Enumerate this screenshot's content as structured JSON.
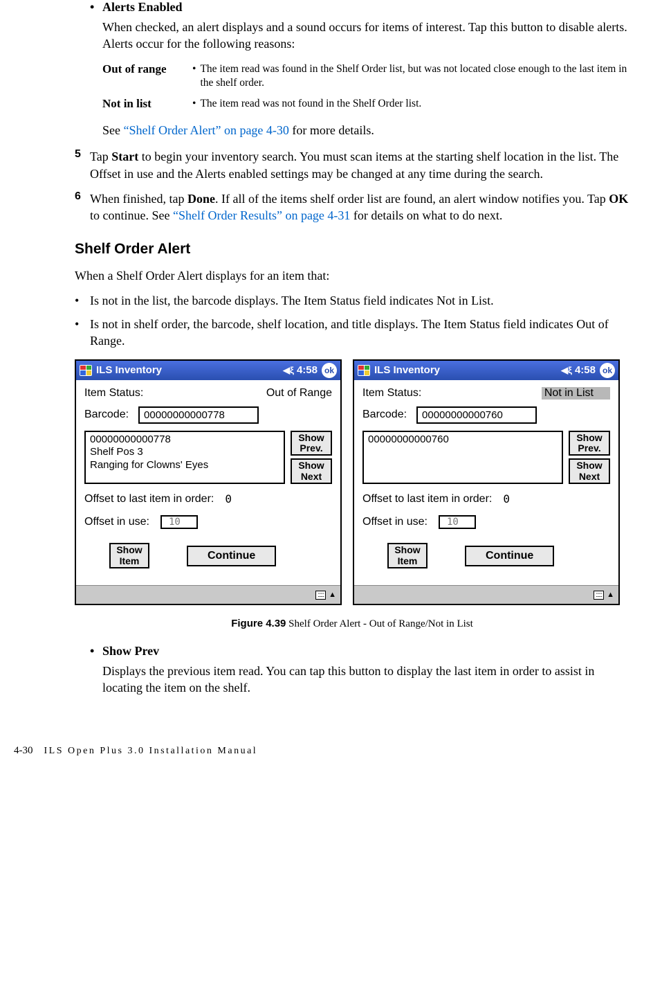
{
  "bullet_alerts_heading": "Alerts Enabled",
  "alerts_para": "When checked, an alert displays and a sound occurs for items of interest. Tap this button to disable alerts. Alerts occur for the following reasons:",
  "alert_table": {
    "out_of_range_term": "Out of range",
    "out_of_range_desc": "The item read was found in the Shelf Order list, but was not located close enough to the last item in the shelf order.",
    "not_in_list_term": "Not in list",
    "not_in_list_desc": "The item read was not found in the Shelf Order list."
  },
  "see_prefix": "See ",
  "see_link": "“Shelf Order Alert” on page 4-30",
  "see_suffix": " for more details.",
  "step5_num": "5",
  "step5_a": "Tap ",
  "step5_b": "Start",
  "step5_c": " to begin your inventory search. You must scan items at the starting shelf location in the list. The Offset in use and the Alerts enabled settings may be changed at any time during the search.",
  "step6_num": "6",
  "step6_a": "When finished, tap ",
  "step6_b": "Done",
  "step6_c": ". If all of the items shelf order list are found, an alert window notifies you. Tap ",
  "step6_d": "OK",
  "step6_e": " to continue. See ",
  "step6_link": "“Shelf Order Results” on page 4-31",
  "step6_f": " for details on what to do next.",
  "section_heading": "Shelf Order Alert",
  "section_intro": "When a Shelf Order Alert displays for an item that:",
  "list1": "Is not in the list, the barcode displays. The Item Status field indicates Not in List.",
  "list2": "Is not in shelf order, the barcode, shelf location, and title displays. The Item Status field indicates Out of Range.",
  "screens": {
    "app_title": "ILS Inventory",
    "time": "4:58",
    "ok": "ok",
    "item_status_label": "Item Status:",
    "barcode_label": "Barcode:",
    "show_prev": "Show\nPrev.",
    "show_next": "Show\nNext",
    "offset_last_label": "Offset to last item in order:",
    "offset_last_val": "0",
    "offset_inuse_label": "Offset in use:",
    "offset_inuse_val": "10",
    "show_item": "Show\nItem",
    "continue": "Continue",
    "left": {
      "status": "Out of Range",
      "barcode": "00000000000778",
      "line1": "00000000000778",
      "line2": "Shelf Pos 3",
      "line3": "Ranging for Clowns' Eyes"
    },
    "right": {
      "status": "Not in List",
      "barcode": "00000000000760",
      "line1": "00000000000760",
      "line2": "",
      "line3": ""
    }
  },
  "figure_label": "Figure 4.39",
  "figure_caption": " Shelf Order Alert - Out of Range/Not in List",
  "show_prev_heading": "Show Prev",
  "show_prev_para": "Displays the previous item read. You can tap this button to display the last item in order to assist in locating the item on the shelf.",
  "footer_page": "4-30",
  "footer_text": "ILS Open Plus 3.0 Installation Manual"
}
